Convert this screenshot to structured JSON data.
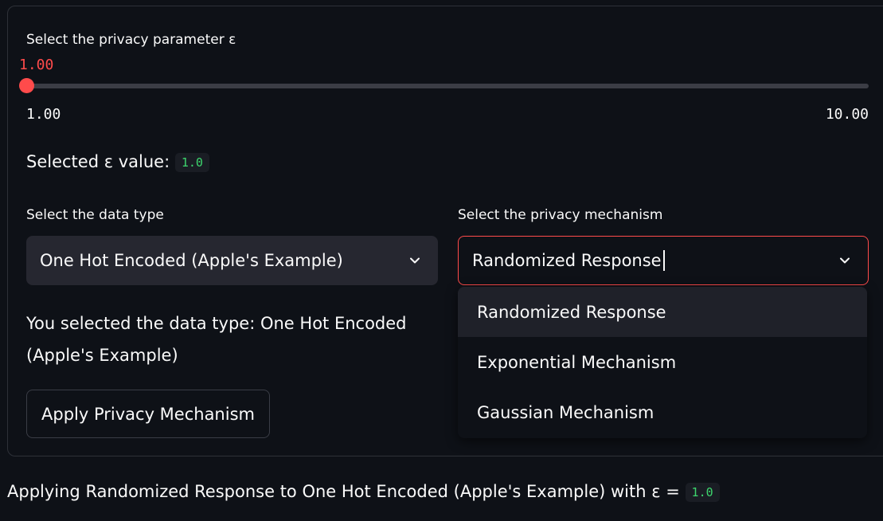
{
  "epsilon_slider": {
    "label": "Select the privacy parameter ε",
    "current_value": "1.00",
    "min_label": "1.00",
    "max_label": "10.00",
    "value": 1.0,
    "min": 1.0,
    "max": 10.0
  },
  "selected_epsilon": {
    "text": "Selected ε value:",
    "value": "1.0"
  },
  "data_type": {
    "label": "Select the data type",
    "value": "One Hot Encoded (Apple's Example)",
    "description": "You selected the data type: One Hot Encoded (Apple's Example)"
  },
  "mechanism": {
    "label": "Select the privacy mechanism",
    "value": "Randomized Response",
    "options": [
      "Randomized Response",
      "Exponential Mechanism",
      "Gaussian Mechanism"
    ]
  },
  "apply_button": {
    "label": "Apply Privacy Mechanism"
  },
  "result": {
    "text": "Applying Randomized Response to One Hot Encoded (Apple's Example) with ε =",
    "value": "1.0"
  },
  "colors": {
    "background": "#0e1117",
    "accent": "#ff4b4b",
    "code_text": "#3dd56d",
    "select_bg": "#262730"
  },
  "icons": {
    "select_chevron": "chevron-down-icon"
  }
}
